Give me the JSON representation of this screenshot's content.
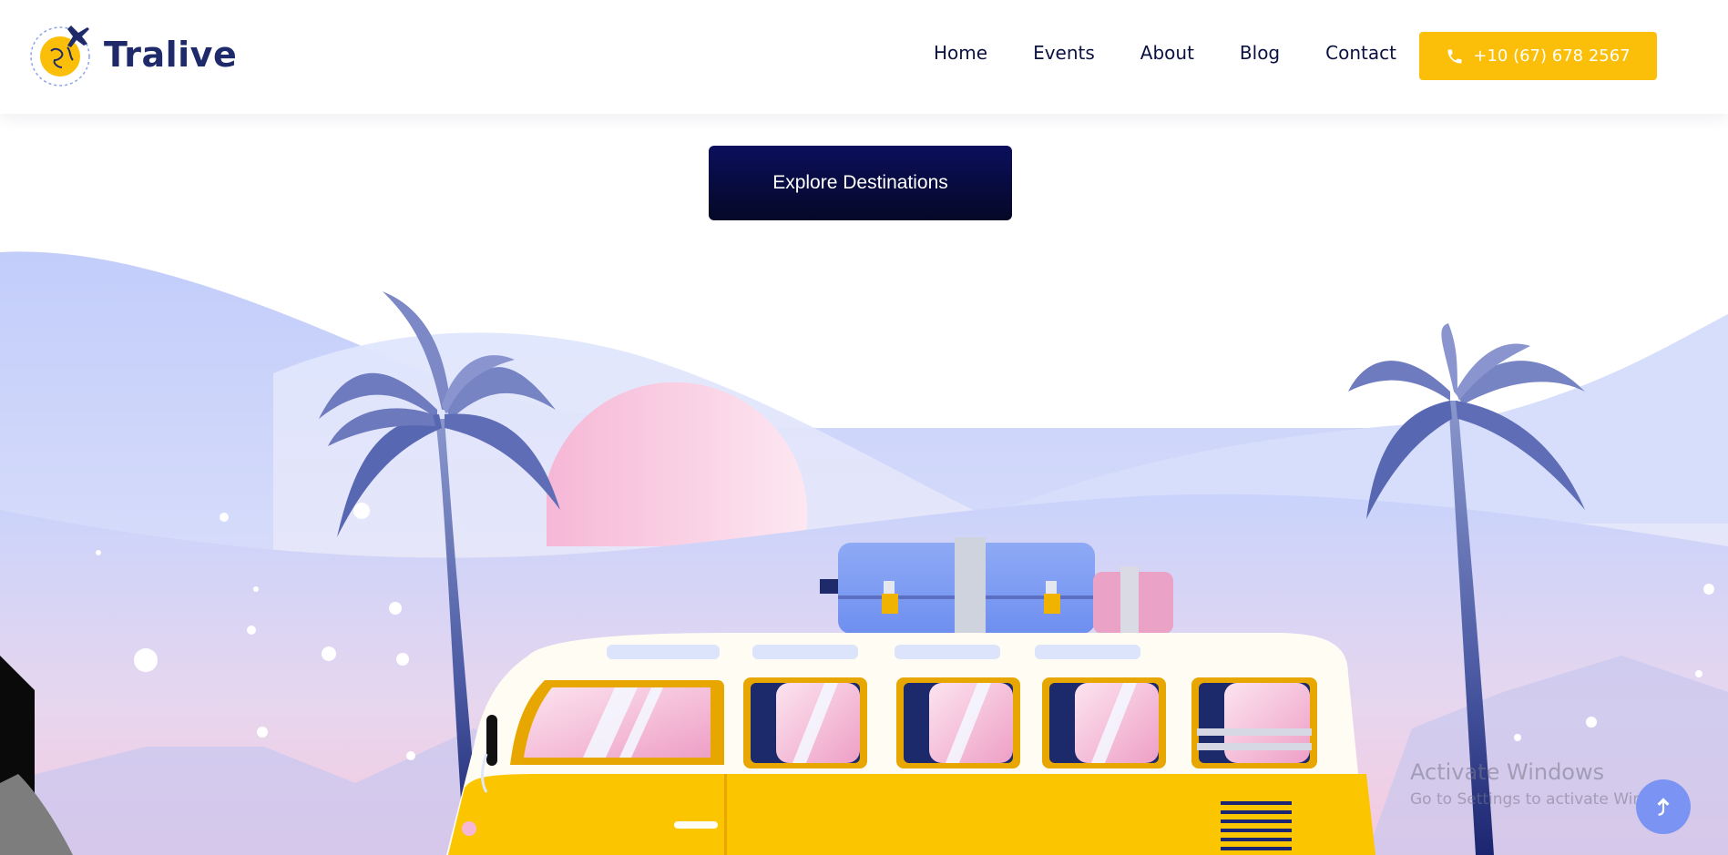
{
  "brand": {
    "name": "Tralive",
    "logo_icon": "globe-with-airplane-icon"
  },
  "nav": {
    "items": [
      "Home",
      "Events",
      "About",
      "Blog",
      "Contact"
    ]
  },
  "phone_button": {
    "label": "+10 (67) 678 2567",
    "icon": "phone-icon"
  },
  "hero": {
    "cta_label": "Explore Destinations"
  },
  "windows_watermark": {
    "title": "Activate Windows",
    "subtitle": "Go to Settings to activate Windows."
  },
  "scroll_top": {
    "icon": "arrow-up-icon"
  },
  "colors": {
    "accent_yellow": "#fbbf0a",
    "navy": "#0b0f5c",
    "sky_blue": "#b9c5f5",
    "pink": "#f3a9cf"
  }
}
